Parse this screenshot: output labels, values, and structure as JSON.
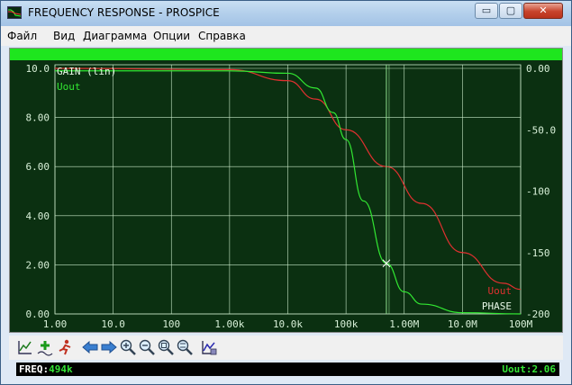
{
  "window": {
    "title": "FREQUENCY RESPONSE - PROSPICE",
    "controls": {
      "minimize": "▭",
      "maximize": "▢",
      "close": "✕"
    }
  },
  "menu": {
    "items": [
      "Файл",
      "Вид",
      "Диаграмма",
      "Опции",
      "Справка"
    ]
  },
  "graph": {
    "left_axis_title": "GAIN (lin)",
    "left_series_label": "Uout",
    "right_series_label": "Uout",
    "right_axis_title": "PHASE",
    "left_ticks": [
      "10.0",
      "8.00",
      "6.00",
      "4.00",
      "2.00",
      "0.00"
    ],
    "right_ticks": [
      "0.00",
      "-50.0",
      "-100",
      "-150",
      "-200"
    ],
    "x_ticks": [
      "1.00",
      "10.0",
      "100",
      "1.00k",
      "10.0k",
      "100k",
      "1.00M",
      "10.0M",
      "100M"
    ],
    "colors": {
      "background": "#0b3011",
      "grid": "#c8e8c8",
      "gain": "#32e832",
      "phase": "#e03030",
      "cursor": "#90e090",
      "topbar": "#1ee61e"
    }
  },
  "chart_data": {
    "type": "line",
    "x_scale": "log",
    "xlim": [
      1,
      100000000
    ],
    "series": [
      {
        "name": "Uout",
        "axis": "GAIN (lin)",
        "x": [
          1,
          100000,
          1000000,
          10000000,
          100000000,
          1000,
          10000,
          30000,
          60000,
          200000,
          494000,
          2000000
        ],
        "y": [
          9.9,
          7.1,
          0.9,
          0.05,
          0.0,
          9.9,
          9.8,
          9.2,
          8.2,
          4.6,
          2.06,
          0.4
        ]
      },
      {
        "name": "Uout",
        "axis": "PHASE",
        "x": [
          1,
          1000,
          10000,
          30000,
          100000,
          494000,
          2000000,
          10000000,
          50000000,
          100000000
        ],
        "y": [
          0,
          -1,
          -10,
          -25,
          -50,
          -80,
          -110,
          -150,
          -175,
          -180
        ]
      }
    ],
    "left_ylim": [
      0,
      10
    ],
    "right_ylim": [
      -200,
      0
    ],
    "cursor_x": 494000
  },
  "toolbar": {
    "buttons": [
      "graph-icon",
      "add-trace-icon",
      "run-icon",
      "arrow-left-icon",
      "arrow-right-icon",
      "zoom-in-icon",
      "zoom-out-icon",
      "zoom-fit-icon",
      "zoom-area-icon",
      "print-graph-icon"
    ]
  },
  "status": {
    "freq_label": "FREQ:",
    "freq_value": "494k",
    "uout_label": "Uout:",
    "uout_value": "2.06"
  }
}
